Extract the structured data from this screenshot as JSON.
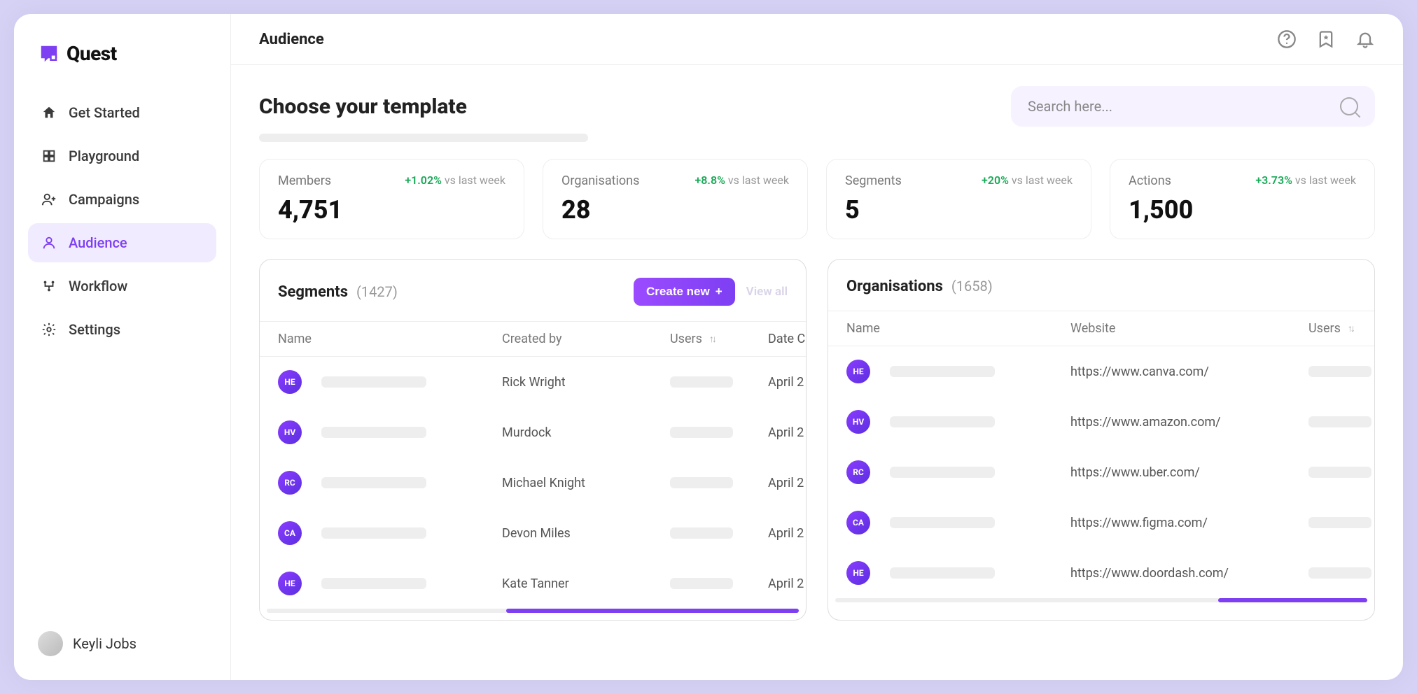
{
  "brand": {
    "name": "Quest"
  },
  "user": {
    "name": "Keyli Jobs"
  },
  "page": {
    "title": "Audience",
    "subtitle": "Choose your template"
  },
  "search": {
    "placeholder": "Search here..."
  },
  "nav": {
    "items": [
      {
        "label": "Get Started"
      },
      {
        "label": "Playground"
      },
      {
        "label": "Campaigns"
      },
      {
        "label": "Audience"
      },
      {
        "label": "Workflow"
      },
      {
        "label": "Settings"
      }
    ]
  },
  "stats": [
    {
      "label": "Members",
      "value": "4,751",
      "delta": "+1.02%",
      "period": "vs last week"
    },
    {
      "label": "Organisations",
      "value": "28",
      "delta": "+8.8%",
      "period": "vs last week"
    },
    {
      "label": "Segments",
      "value": "5",
      "delta": "+20%",
      "period": "vs last week"
    },
    {
      "label": "Actions",
      "value": "1,500",
      "delta": "+3.73%",
      "period": "vs last week"
    }
  ],
  "segments": {
    "title": "Segments",
    "count": "(1427)",
    "create_label": "Create new",
    "view_all": "View all",
    "columns": {
      "name": "Name",
      "created_by": "Created by",
      "users": "Users",
      "date": "Date Created"
    },
    "rows": [
      {
        "initials": "HE",
        "created_by": "Rick Wright",
        "date": "April 2"
      },
      {
        "initials": "HV",
        "created_by": "Murdock",
        "date": "April 2"
      },
      {
        "initials": "RC",
        "created_by": "Michael Knight",
        "date": "April 2"
      },
      {
        "initials": "CA",
        "created_by": "Devon Miles",
        "date": "April 2"
      },
      {
        "initials": "HE",
        "created_by": "Kate Tanner",
        "date": "April 2"
      }
    ]
  },
  "organisations": {
    "title": "Organisations",
    "count": "(1658)",
    "columns": {
      "name": "Name",
      "website": "Website",
      "users": "Users"
    },
    "rows": [
      {
        "initials": "HE",
        "website": "https://www.canva.com/"
      },
      {
        "initials": "HV",
        "website": "https://www.amazon.com/"
      },
      {
        "initials": "RC",
        "website": "https://www.uber.com/"
      },
      {
        "initials": "CA",
        "website": "https://www.figma.com/"
      },
      {
        "initials": "HE",
        "website": "https://www.doordash.com/"
      }
    ]
  }
}
